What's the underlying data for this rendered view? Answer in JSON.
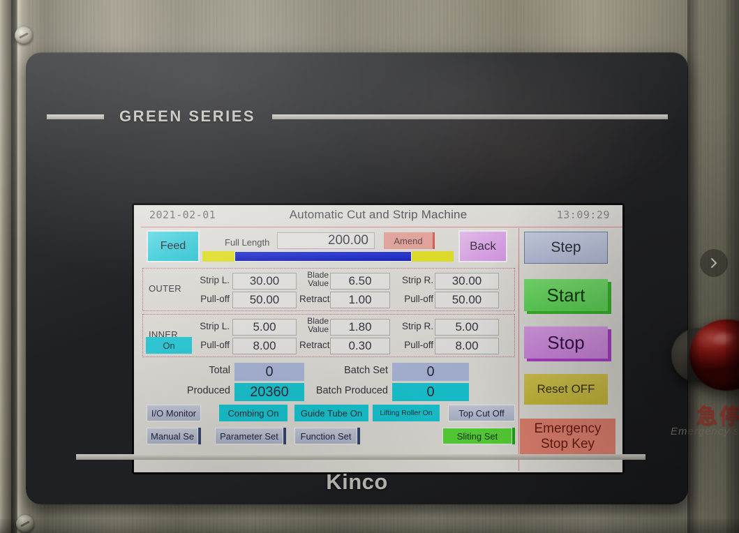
{
  "machine": {
    "brand_series": "GREEN SERIES",
    "hmi_brand": "Kinco",
    "emergency_label_cn": "急停",
    "emergency_label_en": "Emergency stop"
  },
  "overlay": {
    "next_icon": "chevron-right-icon"
  },
  "screen": {
    "header": {
      "date": "2021-02-01",
      "title": "Automatic Cut and Strip Machine",
      "time": "13:09:29"
    },
    "top_row": {
      "feed_label": "Feed",
      "full_length_label": "Full Length",
      "full_length_value": "200.00",
      "amend_label": "Amend",
      "back_label": "Back"
    },
    "outer": {
      "group_label": "OUTER",
      "strip_l_label": "Strip L.",
      "strip_l_value": "30.00",
      "blade_value_label": "Blade Value",
      "blade_value_line1": "Blade",
      "blade_value_line2": "Value",
      "blade_value": "6.50",
      "strip_r_label": "Strip R.",
      "strip_r_value": "30.00",
      "pull_off_l_label": "Pull-off",
      "pull_off_l_value": "50.00",
      "retract_label": "Retract",
      "retract_value": "1.00",
      "pull_off_r_label": "Pull-off",
      "pull_off_r_value": "50.00"
    },
    "inner": {
      "group_label": "INNER",
      "on_toggle_label": "On",
      "strip_l_label": "Strip L.",
      "strip_l_value": "5.00",
      "blade_value_line1": "Blade",
      "blade_value_line2": "Value",
      "blade_value": "1.80",
      "strip_r_label": "Strip R.",
      "strip_r_value": "5.00",
      "pull_off_l_label": "Pull-off",
      "pull_off_l_value": "8.00",
      "retract_label": "Retract",
      "retract_value": "0.30",
      "pull_off_r_label": "Pull-off",
      "pull_off_r_value": "8.00"
    },
    "counters": {
      "total_label": "Total",
      "total_value": "0",
      "produced_label": "Produced",
      "produced_value": "20360",
      "batch_set_label": "Batch Set",
      "batch_set_value": "0",
      "batch_produced_label": "Batch Produced",
      "batch_produced_value": "0"
    },
    "button_row_1": [
      {
        "label": "I/O Monitor",
        "style": "grey"
      },
      {
        "label": "Combing On",
        "style": "cyan"
      },
      {
        "label": "Guide Tube On",
        "style": "cyan"
      },
      {
        "label": "Lifting Roller On",
        "style": "cyan"
      },
      {
        "label": "Top Cut Off",
        "style": "grey"
      }
    ],
    "button_row_2": [
      {
        "label": "Manual Se",
        "style": "grey"
      },
      {
        "label": "Parameter Set",
        "style": "grey"
      },
      {
        "label": "Function Set",
        "style": "grey"
      },
      {
        "label": "Sliting Set",
        "style": "green"
      }
    ],
    "control_column": {
      "step_label": "Step",
      "start_label": "Start",
      "stop_label": "Stop",
      "reset_label": "Reset OFF",
      "estop_line1": "Emergency",
      "estop_line2": "Stop Key"
    },
    "colors": {
      "screen_bg": "#eceae4",
      "accent_rule": "#e8808c",
      "cyan": "#19d3e0",
      "start_green": "#7eec74",
      "stop_purple": "#e8a6f6",
      "reset_yellow": "#e3d455",
      "estop_salmon": "#f08a76",
      "field_bg": "#f2f1ee",
      "counter_blue": "#b5c1e6",
      "progress_blue": "#1d2ee0",
      "progress_yellow": "#f0ee1c"
    }
  }
}
